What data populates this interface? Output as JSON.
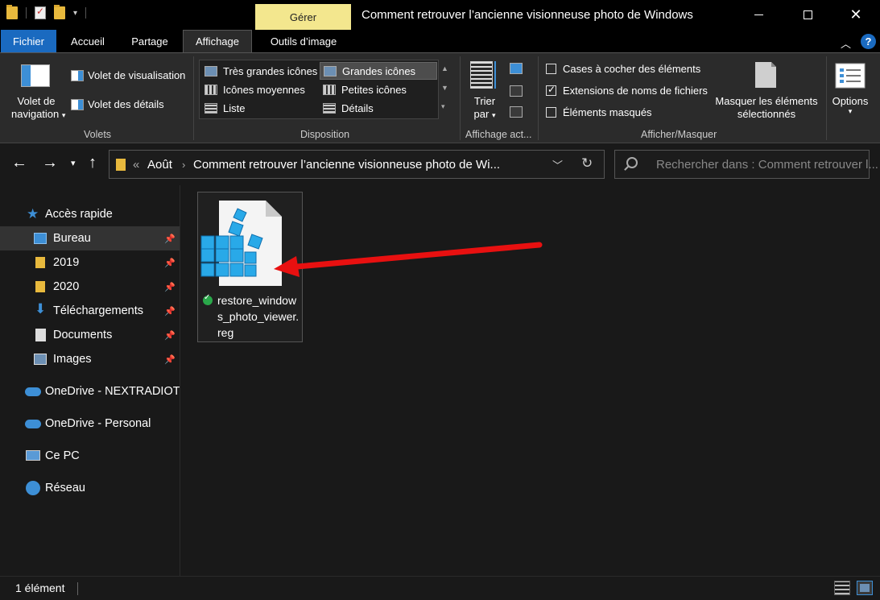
{
  "window": {
    "title": "Comment retrouver l’ancienne visionneuse photo de Windows",
    "contextual_tab": "Gérer"
  },
  "ribbon_tabs": [
    "Fichier",
    "Accueil",
    "Partage",
    "Affichage",
    "Outils d’image"
  ],
  "ribbon": {
    "volets": {
      "nav_pane_line1": "Volet de",
      "nav_pane_line2": "navigation",
      "preview_pane": "Volet de visualisation",
      "details_pane": "Volet des détails",
      "group_label": "Volets"
    },
    "disposition": {
      "items": [
        "Très grandes icônes",
        "Grandes icônes",
        "Icônes moyennes",
        "Petites icônes",
        "Liste",
        "Détails"
      ],
      "selected": "Grandes icônes",
      "group_label": "Disposition"
    },
    "affichage_actuel": {
      "sort_line1": "Trier",
      "sort_line2": "par",
      "group_label": "Affichage act..."
    },
    "afficher_masquer": {
      "checkboxes": [
        {
          "label": "Cases à cocher des éléments",
          "checked": false
        },
        {
          "label": "Extensions de noms de fichiers",
          "checked": true
        },
        {
          "label": "Éléments masqués",
          "checked": false
        }
      ],
      "hide_selected_line1": "Masquer les éléments",
      "hide_selected_line2": "sélectionnés",
      "group_label": "Afficher/Masquer"
    },
    "options": {
      "label": "Options"
    }
  },
  "address": {
    "overflow": "«",
    "crumbs": [
      "Août",
      "Comment retrouver l’ancienne visionneuse photo de Wi..."
    ]
  },
  "search": {
    "placeholder": "Rechercher dans : Comment retrouver l..."
  },
  "sidebar": {
    "items": [
      {
        "label": "Accès rapide",
        "icon": "star-icon"
      },
      {
        "label": "Bureau",
        "icon": "desktop-icon",
        "pinned": true
      },
      {
        "label": "2019",
        "icon": "folder-icon",
        "pinned": true
      },
      {
        "label": "2020",
        "icon": "folder-icon",
        "pinned": true
      },
      {
        "label": "Téléchargements",
        "icon": "download-icon",
        "pinned": true
      },
      {
        "label": "Documents",
        "icon": "document-icon",
        "pinned": true
      },
      {
        "label": "Images",
        "icon": "pictures-icon",
        "pinned": true
      },
      {
        "label": "OneDrive - NEXTRADIOT",
        "icon": "onedrive-icon"
      },
      {
        "label": "OneDrive - Personal",
        "icon": "onedrive-icon"
      },
      {
        "label": "Ce PC",
        "icon": "pc-icon"
      },
      {
        "label": "Réseau",
        "icon": "network-icon"
      }
    ]
  },
  "files": [
    {
      "name": "restore_windows_photo_viewer.reg",
      "icon": "registry-file-icon",
      "sync_status": "synced"
    }
  ],
  "status": {
    "count": "1 élément"
  },
  "colors": {
    "accent": "#1a6ac0",
    "manage_tab": "#f3e78e",
    "arrow": "#e81010"
  }
}
